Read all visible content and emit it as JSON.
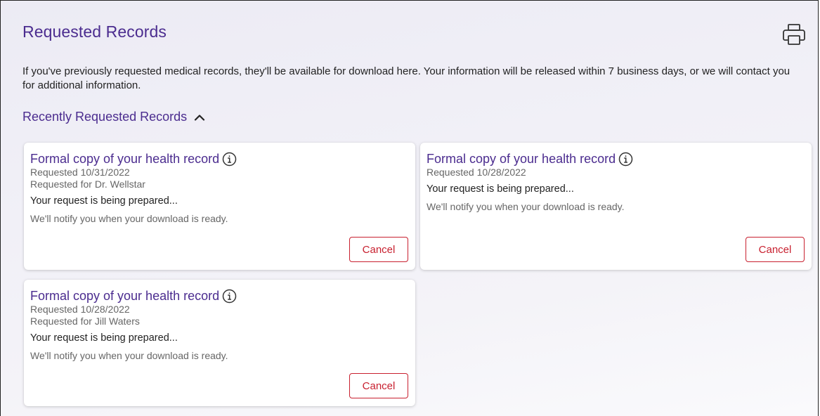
{
  "page": {
    "title": "Requested Records",
    "intro": "If you've previously requested medical records, they'll be available for download here. Your information will be released within 7 business days, or we will contact you for additional information.",
    "print_icon": "printer-icon"
  },
  "section": {
    "header": "Recently Requested Records",
    "toggle_icon": "chevron-up-icon",
    "expanded": true
  },
  "records": [
    {
      "title": "Formal copy of your health record",
      "requested": "Requested 10/31/2022",
      "requested_for": "Requested for Dr. Wellstar",
      "status": "Your request is being prepared...",
      "note": "We'll notify you when your download is ready.",
      "cancel_label": "Cancel"
    },
    {
      "title": "Formal copy of your health record",
      "requested": "Requested 10/28/2022",
      "status": "Your request is being prepared...",
      "note": "We'll notify you when your download is ready.",
      "cancel_label": "Cancel"
    },
    {
      "title": "Formal copy of your health record",
      "requested": "Requested 10/28/2022",
      "requested_for": "Requested for Jill Waters",
      "status": "Your request is being prepared...",
      "note": "We'll notify you when your download is ready.",
      "cancel_label": "Cancel"
    }
  ],
  "colors": {
    "accent": "#4b2c8f",
    "danger": "#c8202f",
    "text": "#222222",
    "muted": "#666666"
  }
}
